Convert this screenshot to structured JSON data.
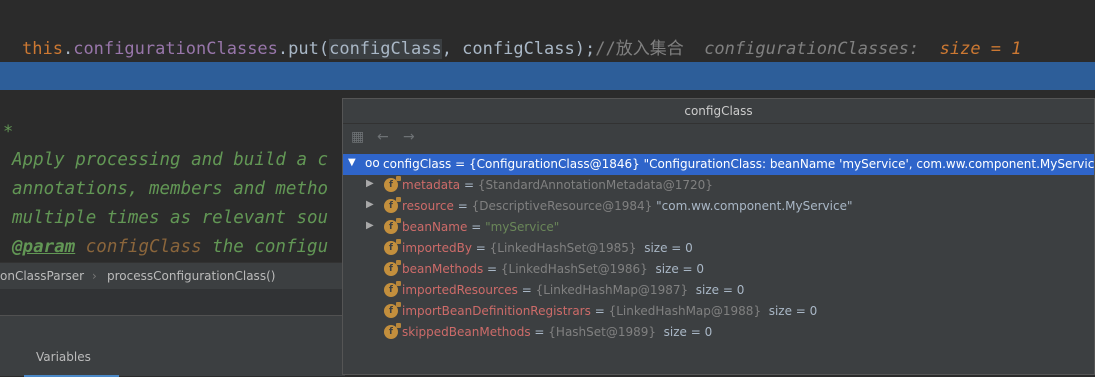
{
  "editor": {
    "code": {
      "kw_this": "this",
      "dot1": ".",
      "field": "configurationClasses",
      "call": ".put(",
      "arg1": "configClass",
      "mid": ", configClass);",
      "comment": "//放入集合",
      "inline_hint_label": "configurationClasses:",
      "inline_hint_value": "size = 1"
    },
    "doc_lines": [
      "Apply processing and build a c",
      "annotations, members and metho",
      "multiple times as relevant sou"
    ],
    "doc_param_tag": "@param",
    "doc_param_name": "configClass",
    "doc_param_rest": "the configu",
    "gutter_star": "*"
  },
  "breadcrumb": {
    "class": "onClassParser",
    "separator": "›",
    "method": "processConfigurationClass()"
  },
  "tool_window": {
    "active_tab": "Variables"
  },
  "popup": {
    "title": "configClass",
    "toolbar": [
      "watch-icon",
      "back-icon",
      "forward-icon"
    ],
    "root": {
      "name": "configClass",
      "eq": " = ",
      "type": "{ConfigurationClass@1846}",
      "value": " \"ConfigurationClass: beanName 'myService', com.ww.component.MyService\""
    },
    "fields": [
      {
        "name": "metadata",
        "type": "{StandardAnnotationMetadata@1720}",
        "value": "",
        "expandable": true,
        "kind": "type"
      },
      {
        "name": "resource",
        "type": "{DescriptiveResource@1984}",
        "value": " \"com.ww.component.MyService\"",
        "expandable": true,
        "kind": "type"
      },
      {
        "name": "beanName",
        "type": "",
        "value": "\"myService\"",
        "expandable": true,
        "kind": "string"
      },
      {
        "name": "importedBy",
        "type": "{LinkedHashSet@1985}",
        "value": "  size = 0",
        "expandable": false,
        "kind": "type"
      },
      {
        "name": "beanMethods",
        "type": "{LinkedHashSet@1986}",
        "value": "  size = 0",
        "expandable": false,
        "kind": "type"
      },
      {
        "name": "importedResources",
        "type": "{LinkedHashMap@1987}",
        "value": "  size = 0",
        "expandable": false,
        "kind": "type"
      },
      {
        "name": "importBeanDefinitionRegistrars",
        "type": "{LinkedHashMap@1988}",
        "value": "  size = 0",
        "expandable": false,
        "kind": "type"
      },
      {
        "name": "skippedBeanMethods",
        "type": "{HashSet@1989}",
        "value": "  size = 0",
        "expandable": false,
        "kind": "type"
      }
    ],
    "field_icon_letter": "f",
    "eq": " = "
  },
  "colors": {
    "editor_bg": "#2b2b2b",
    "exec_line": "#2d5e99",
    "selection": "#2f65ca",
    "field_name": "#cd6b69",
    "string": "#6a8759",
    "keyword": "#cc7832"
  }
}
